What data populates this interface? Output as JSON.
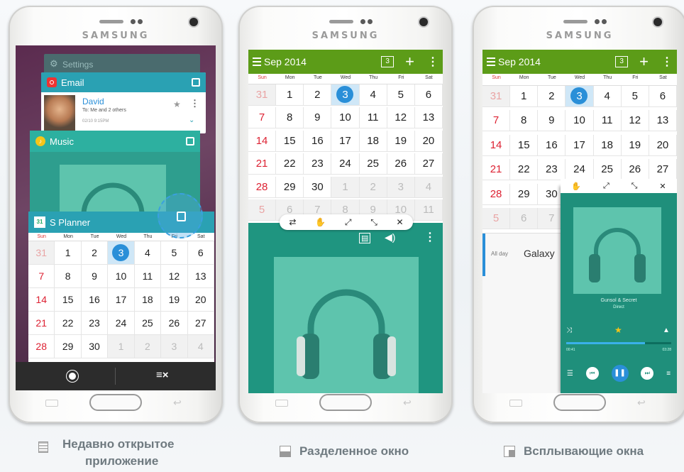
{
  "brand": "SAMSUNG",
  "calendar": {
    "month": "Sep 2014",
    "today_icon": "3",
    "weekdays": [
      "Sun",
      "Mon",
      "Tue",
      "Wed",
      "Thu",
      "Fri",
      "Sat"
    ],
    "rows": [
      [
        "31",
        "1",
        "2",
        "3",
        "4",
        "5",
        "6"
      ],
      [
        "7",
        "8",
        "9",
        "10",
        "11",
        "12",
        "13"
      ],
      [
        "14",
        "15",
        "16",
        "17",
        "18",
        "19",
        "20"
      ],
      [
        "21",
        "22",
        "23",
        "24",
        "25",
        "26",
        "27"
      ],
      [
        "28",
        "29",
        "30",
        "1",
        "2",
        "3",
        "4"
      ],
      [
        "5",
        "6",
        "7",
        "8",
        "9",
        "10",
        "11"
      ]
    ]
  },
  "recent": {
    "settings_label": "Settings",
    "email_label": "Email",
    "email_sender": "David",
    "email_to": "To: Me and 2 others",
    "email_time": "02/10 9:15PM",
    "music_label": "Music",
    "planner_label": "S Planner",
    "planner_icon": "31"
  },
  "popup": {
    "allday": "All day",
    "event": "Galaxy",
    "song": "Gunsol & Secret",
    "artist": "Direct",
    "time_left": "00:41",
    "time_right": "03:28"
  },
  "captions": {
    "recent": "Недавно открытое приложение",
    "recent_line1": "Недавно открытое",
    "recent_line2": "приложение",
    "split": "Разделенное окно",
    "popup": "Всплывающие окна"
  },
  "colors": {
    "calendar_green": "#5c9c18",
    "music_teal": "#1f9580",
    "today_blue": "#2a8fd8",
    "email_teal": "#2aa1b3"
  }
}
